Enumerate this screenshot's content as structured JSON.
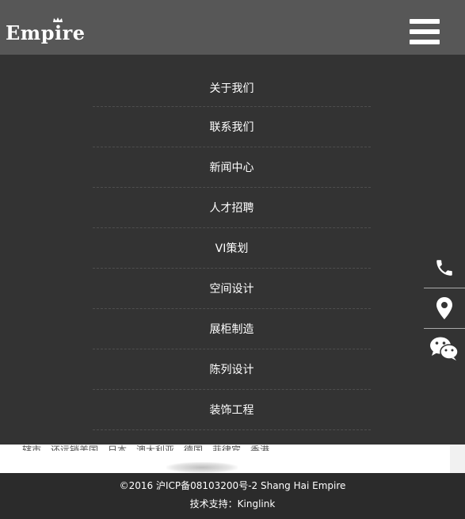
{
  "header": {
    "logo_prefix": "Emp",
    "logo_i": "i",
    "logo_suffix": "re",
    "bg_color": "#575757"
  },
  "nav": {
    "bg_color": "#333333",
    "items": [
      {
        "label": "关于我们"
      },
      {
        "label": "联系我们"
      },
      {
        "label": "新闻中心"
      },
      {
        "label": "人才招聘"
      },
      {
        "label": "VI策划"
      },
      {
        "label": "空间设计"
      },
      {
        "label": "展柜制造"
      },
      {
        "label": "陈列设计"
      },
      {
        "label": "装饰工程"
      }
    ]
  },
  "content": {
    "partial_text": "辖市，还远销美国、日本、澳大利亚、德国、菲律宾、香港。"
  },
  "side_icons": [
    "phone-icon",
    "location-pin-icon",
    "wechat-icon"
  ],
  "footer": {
    "copyright": "©2016  沪ICP备08103200号-2 Shang  Hai  Empire",
    "support": "技术支持：Kinglink",
    "bg_color": "#2b2b2b"
  }
}
